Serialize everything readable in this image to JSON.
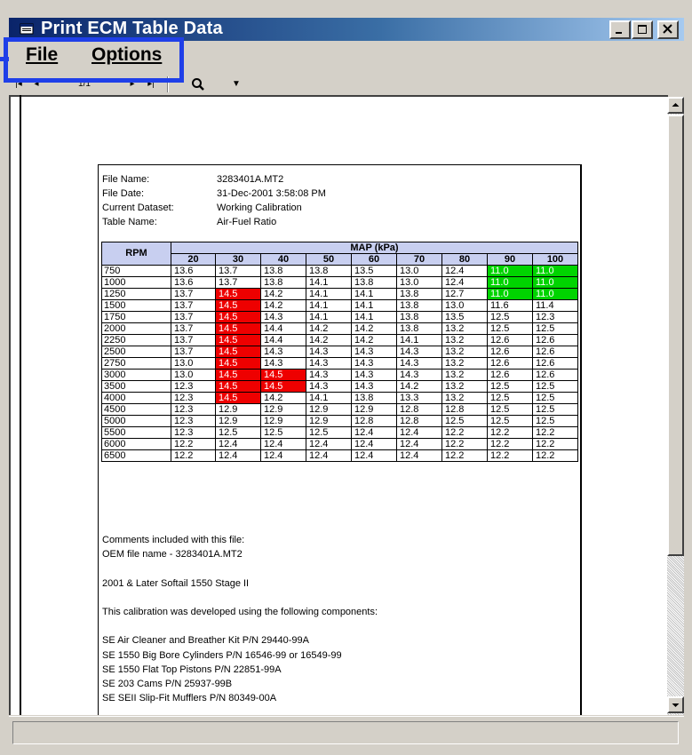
{
  "window": {
    "title": "Print ECM Table Data",
    "menu": {
      "file": "File",
      "options": "Options"
    },
    "toolbar": {
      "first": "|◂",
      "prev": "◂",
      "page": "1/1",
      "next": "▸",
      "last": "▸|",
      "zoom_arrow": "▼"
    },
    "colors": {
      "highlight_box": "#1f3fe8",
      "lean_cells": "#ee0000",
      "rich_cells": "#00d400",
      "header_bg": "#c8cff0"
    }
  },
  "report": {
    "meta": [
      {
        "label": "File Name:",
        "value": "3283401A.MT2"
      },
      {
        "label": "File Date:",
        "value": "31-Dec-2001  3:58:08 PM"
      },
      {
        "label": "Current Dataset:",
        "value": "Working Calibration"
      },
      {
        "label": "Table Name:",
        "value": "Air-Fuel Ratio"
      }
    ],
    "table": {
      "row_header": "RPM",
      "group_header": "MAP (kPa)",
      "columns": [
        "20",
        "30",
        "40",
        "50",
        "60",
        "70",
        "80",
        "90",
        "100"
      ],
      "rows": [
        {
          "rpm": "750",
          "values": [
            "13.6",
            "13.7",
            "13.8",
            "13.8",
            "13.5",
            "13.0",
            "12.4",
            "11.0",
            "11.0"
          ]
        },
        {
          "rpm": "1000",
          "values": [
            "13.6",
            "13.7",
            "13.8",
            "14.1",
            "13.8",
            "13.0",
            "12.4",
            "11.0",
            "11.0"
          ]
        },
        {
          "rpm": "1250",
          "values": [
            "13.7",
            "14.5",
            "14.2",
            "14.1",
            "14.1",
            "13.8",
            "12.7",
            "11.0",
            "11.0"
          ]
        },
        {
          "rpm": "1500",
          "values": [
            "13.7",
            "14.5",
            "14.2",
            "14.1",
            "14.1",
            "13.8",
            "13.0",
            "11.6",
            "11.4"
          ]
        },
        {
          "rpm": "1750",
          "values": [
            "13.7",
            "14.5",
            "14.3",
            "14.1",
            "14.1",
            "13.8",
            "13.5",
            "12.5",
            "12.3"
          ]
        },
        {
          "rpm": "2000",
          "values": [
            "13.7",
            "14.5",
            "14.4",
            "14.2",
            "14.2",
            "13.8",
            "13.2",
            "12.5",
            "12.5"
          ]
        },
        {
          "rpm": "2250",
          "values": [
            "13.7",
            "14.5",
            "14.4",
            "14.2",
            "14.2",
            "14.1",
            "13.2",
            "12.6",
            "12.6"
          ]
        },
        {
          "rpm": "2500",
          "values": [
            "13.7",
            "14.5",
            "14.3",
            "14.3",
            "14.3",
            "14.3",
            "13.2",
            "12.6",
            "12.6"
          ]
        },
        {
          "rpm": "2750",
          "values": [
            "13.0",
            "14.5",
            "14.3",
            "14.3",
            "14.3",
            "14.3",
            "13.2",
            "12.6",
            "12.6"
          ]
        },
        {
          "rpm": "3000",
          "values": [
            "13.0",
            "14.5",
            "14.5",
            "14.3",
            "14.3",
            "14.3",
            "13.2",
            "12.6",
            "12.6"
          ]
        },
        {
          "rpm": "3500",
          "values": [
            "12.3",
            "14.5",
            "14.5",
            "14.3",
            "14.3",
            "14.2",
            "13.2",
            "12.5",
            "12.5"
          ]
        },
        {
          "rpm": "4000",
          "values": [
            "12.3",
            "14.5",
            "14.2",
            "14.1",
            "13.8",
            "13.3",
            "13.2",
            "12.5",
            "12.5"
          ]
        },
        {
          "rpm": "4500",
          "values": [
            "12.3",
            "12.9",
            "12.9",
            "12.9",
            "12.9",
            "12.8",
            "12.8",
            "12.5",
            "12.5"
          ]
        },
        {
          "rpm": "5000",
          "values": [
            "12.3",
            "12.9",
            "12.9",
            "12.9",
            "12.8",
            "12.8",
            "12.5",
            "12.5",
            "12.5"
          ]
        },
        {
          "rpm": "5500",
          "values": [
            "12.3",
            "12.5",
            "12.5",
            "12.5",
            "12.4",
            "12.4",
            "12.2",
            "12.2",
            "12.2"
          ]
        },
        {
          "rpm": "6000",
          "values": [
            "12.2",
            "12.4",
            "12.4",
            "12.4",
            "12.4",
            "12.4",
            "12.2",
            "12.2",
            "12.2"
          ]
        },
        {
          "rpm": "6500",
          "values": [
            "12.2",
            "12.4",
            "12.4",
            "12.4",
            "12.4",
            "12.4",
            "12.2",
            "12.2",
            "12.2"
          ]
        }
      ]
    },
    "comments": [
      "Comments included with this file:",
      "OEM file name - 3283401A.MT2",
      "",
      "2001 & Later Softail 1550 Stage II",
      "",
      "This calibration was developed using the following components:",
      "",
      "SE Air Cleaner and Breather Kit P/N 29440-99A",
      "SE 1550 Big Bore Cylinders P/N 16546-99 or 16549-99",
      "SE 1550 Flat Top Pistons P/N 22851-99A",
      "SE 203 Cams P/N 25937-99B",
      "SE SEII Slip-Fit Mufflers P/N 80349-00A"
    ]
  }
}
